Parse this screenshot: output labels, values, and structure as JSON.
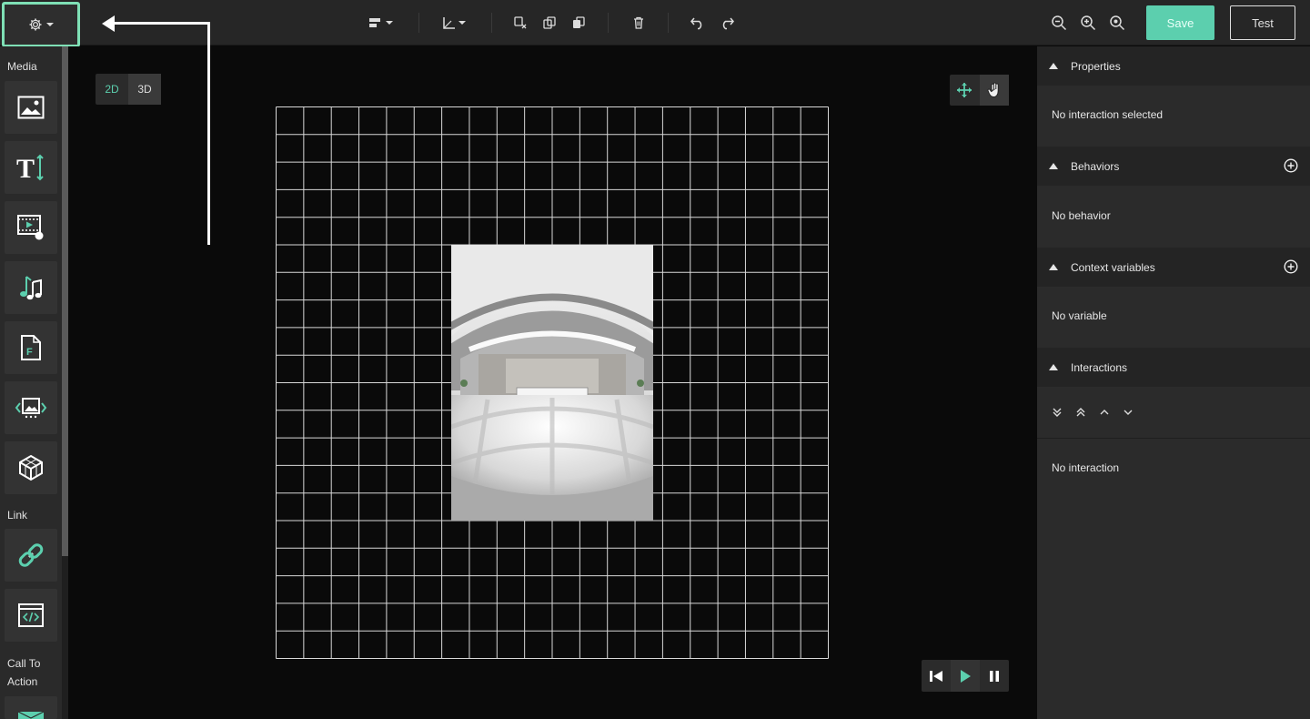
{
  "toolbar": {
    "save_label": "Save",
    "test_label": "Test",
    "icons": [
      "gear-icon",
      "align-icon",
      "axis-icon",
      "duplicate-icon",
      "copy-icon",
      "paste-icon",
      "trash-icon",
      "undo-icon",
      "redo-icon",
      "zoom-out-icon",
      "zoom-in-icon",
      "zoom-fit-icon"
    ]
  },
  "sidebar": {
    "sections": {
      "media": "Media",
      "link": "Link",
      "cta_line1": "Call To",
      "cta_line2": "Action"
    },
    "tools": [
      "image-tool",
      "text-tool",
      "video-tool",
      "audio-tool",
      "file-tool",
      "gallery-tool",
      "3d-object-tool",
      "link-tool",
      "embed-tool",
      "email-tool"
    ]
  },
  "canvas": {
    "toggle_2d": "2D",
    "toggle_3d": "3D"
  },
  "right_panel": {
    "properties": {
      "title": "Properties",
      "empty": "No interaction selected"
    },
    "behaviors": {
      "title": "Behaviors",
      "empty": "No behavior"
    },
    "context_variables": {
      "title": "Context variables",
      "empty": "No variable"
    },
    "interactions": {
      "title": "Interactions",
      "empty": "No interaction"
    }
  },
  "colors": {
    "accent": "#5ccfae",
    "highlight_border": "#7fe0b6",
    "panel_bg": "#2b2b2b"
  }
}
